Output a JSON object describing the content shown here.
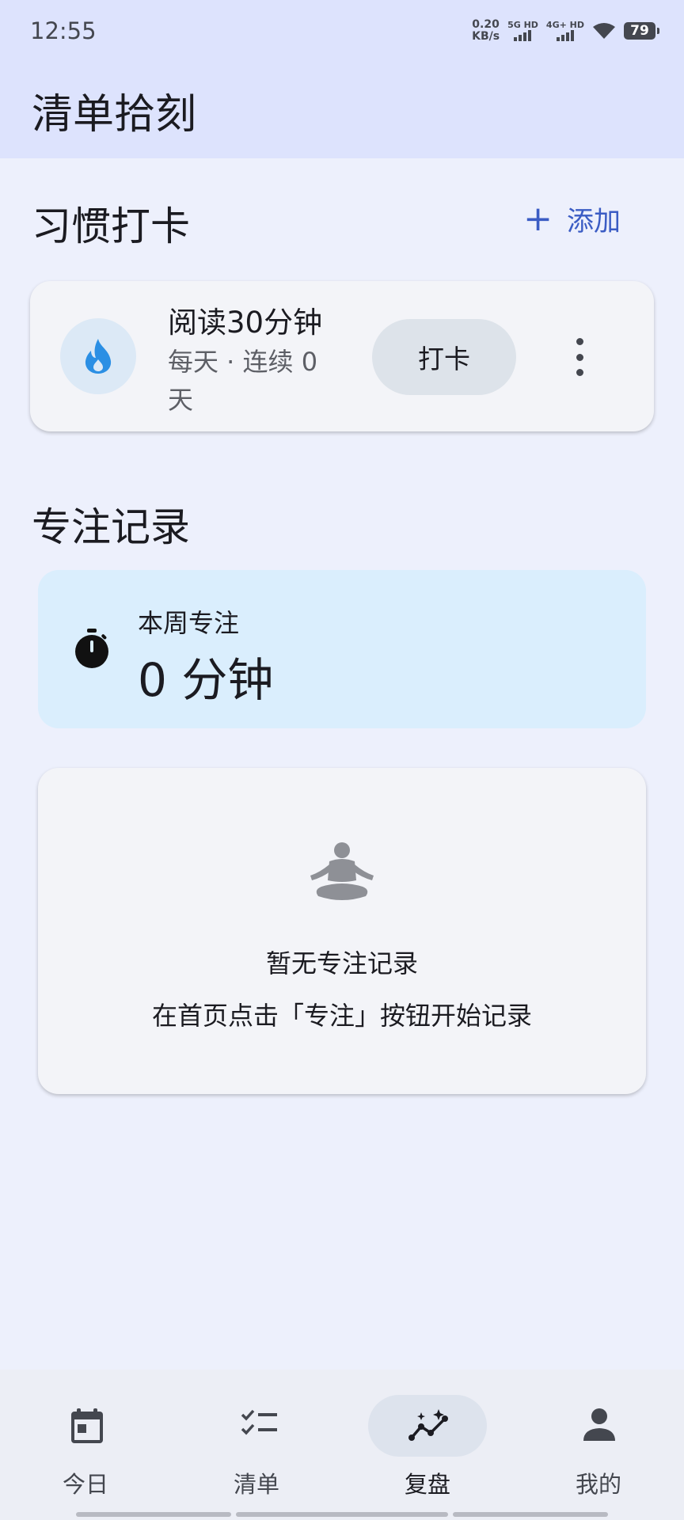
{
  "status_bar": {
    "time": "12:55",
    "net_speed_value": "0.20",
    "net_speed_unit": "KB/s",
    "sim1_label": "5G HD",
    "sim2_label": "4G+ HD",
    "battery": "79"
  },
  "app_bar": {
    "title": "清单拾刻"
  },
  "habits": {
    "section_title": "习惯打卡",
    "add_label": "添加",
    "add_icon": "plus-icon",
    "items": [
      {
        "name": "阅读30分钟",
        "meta": "每天 · 连续 0 天",
        "checkin_label": "打卡",
        "icon": "fire-icon"
      }
    ]
  },
  "focus": {
    "section_title": "专注记录",
    "week_label": "本周专注",
    "week_value": "0 分钟",
    "empty_title": "暂无专注记录",
    "empty_hint": "在首页点击「专注」按钮开始记录"
  },
  "bottom_nav": {
    "items": [
      {
        "label": "今日",
        "icon": "calendar-icon",
        "active": false
      },
      {
        "label": "清单",
        "icon": "checklist-icon",
        "active": false
      },
      {
        "label": "复盘",
        "icon": "insights-icon",
        "active": true
      },
      {
        "label": "我的",
        "icon": "person-icon",
        "active": false
      }
    ]
  },
  "colors": {
    "accent": "#3b5cc4",
    "habit_icon": "#2b8fe4",
    "focus_card_bg": "#daeefd",
    "app_bar_bg": "#dde3fd"
  }
}
